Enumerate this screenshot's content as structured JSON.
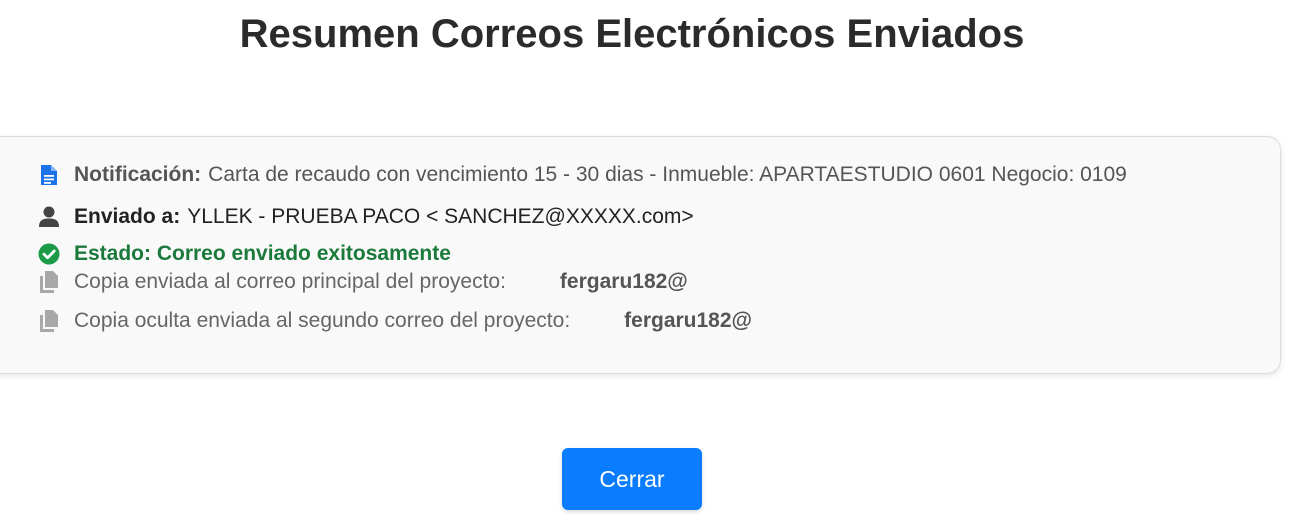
{
  "page": {
    "title": "Resumen Correos Electrónicos Enviados"
  },
  "summary": {
    "notification": {
      "icon": "document-icon",
      "label": "Notificación:",
      "value": "Carta de recaudo con vencimiento 15 - 30 dias - Inmueble: APARTAESTUDIO 0601 Negocio: 0109"
    },
    "recipient": {
      "icon": "user-icon",
      "label": "Enviado a:",
      "value": "YLLEK - PRUEBA PACO <   SANCHEZ@XXXXX.com>"
    },
    "status": {
      "icon": "check-circle-icon",
      "label": "Estado: Correo enviado exitosamente",
      "color": "#1b7a3b"
    },
    "cc": {
      "icon": "copy-icon",
      "text": "Copia enviada al correo principal del proyecto:",
      "email": "fergaru182@"
    },
    "bcc": {
      "icon": "copy-icon",
      "text": "Copia oculta enviada al segundo correo del proyecto:",
      "email": "fergaru182@"
    }
  },
  "actions": {
    "close_label": "Cerrar",
    "accent": "#0a7cff"
  }
}
